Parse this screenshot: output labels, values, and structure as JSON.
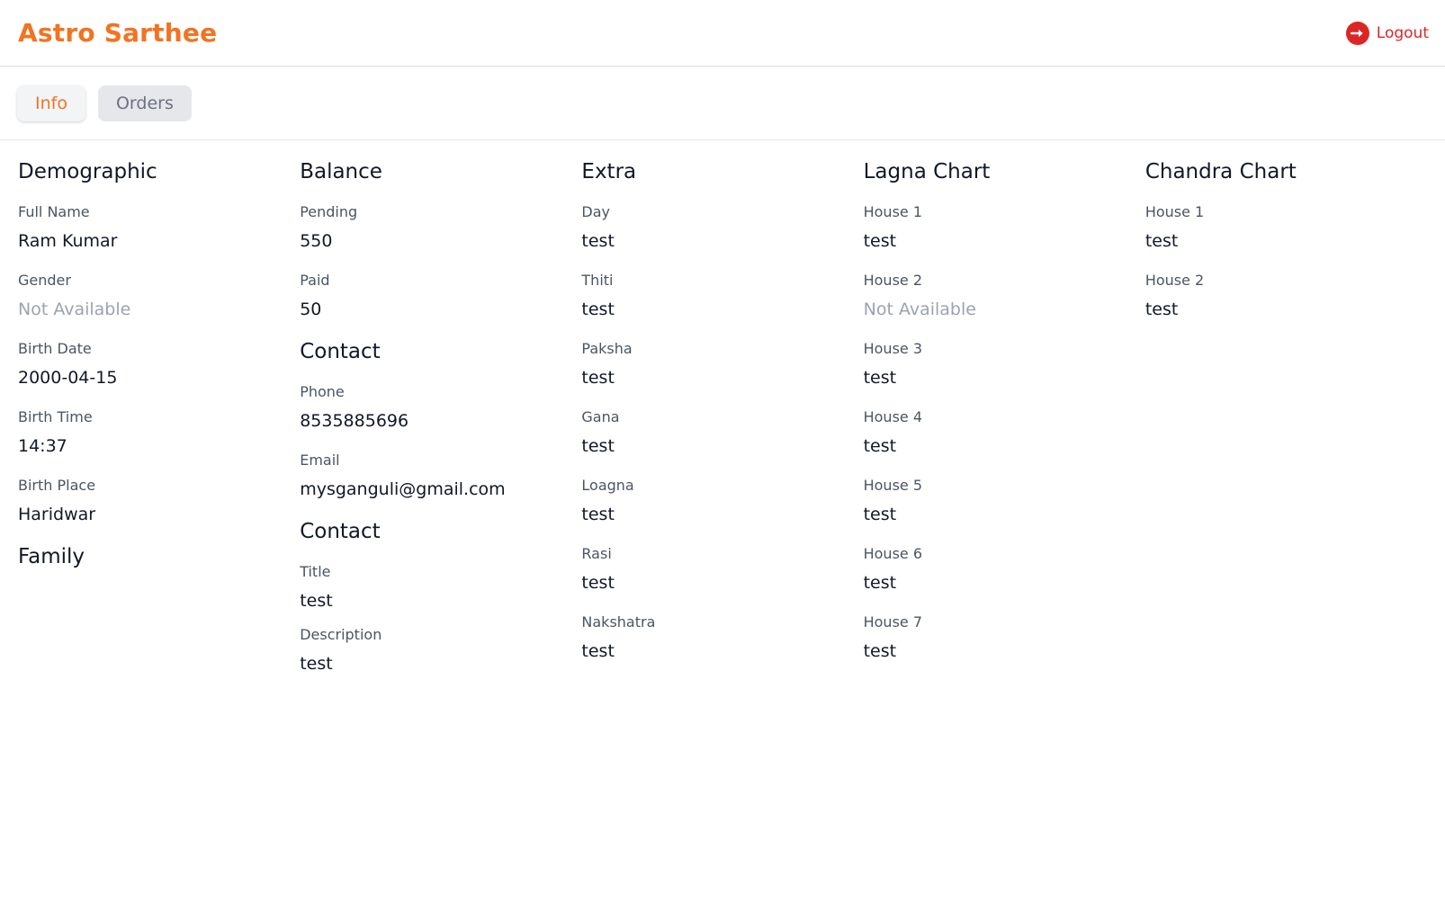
{
  "header": {
    "brand": "Astro Sarthee",
    "logout_label": "Logout"
  },
  "tabs": [
    {
      "label": "Info",
      "active": true
    },
    {
      "label": "Orders",
      "active": false
    }
  ],
  "demographic": {
    "title": "Demographic",
    "fields": [
      {
        "label": "Full Name",
        "value": "Ram Kumar"
      },
      {
        "label": "Gender",
        "value": "Not Available"
      },
      {
        "label": "Birth Date",
        "value": "2000-04-15"
      },
      {
        "label": "Birth Time",
        "value": "14:37"
      },
      {
        "label": "Birth Place",
        "value": "Haridwar"
      }
    ]
  },
  "family": {
    "title": "Family"
  },
  "balance": {
    "title": "Balance",
    "fields": [
      {
        "label": "Pending",
        "value": "550"
      },
      {
        "label": "Paid",
        "value": "50"
      }
    ]
  },
  "contact": {
    "title": "Contact",
    "fields": [
      {
        "label": "Phone",
        "value": "8535885696"
      },
      {
        "label": "Email",
        "value": "mysganguli@gmail.com"
      }
    ]
  },
  "contact2": {
    "title": "Contact",
    "fields": [
      {
        "label": "Title",
        "value": "test"
      },
      {
        "label": "Description",
        "value": "test"
      }
    ]
  },
  "extra": {
    "title": "Extra",
    "fields": [
      {
        "label": "Day",
        "value": "test"
      },
      {
        "label": "Thiti",
        "value": "test"
      },
      {
        "label": "Paksha",
        "value": "test"
      },
      {
        "label": "Gana",
        "value": "test"
      },
      {
        "label": "Loagna",
        "value": "test"
      },
      {
        "label": "Rasi",
        "value": "test"
      },
      {
        "label": "Nakshatra",
        "value": "test"
      }
    ]
  },
  "lagna": {
    "title": "Lagna Chart",
    "fields": [
      {
        "label": "House 1",
        "value": "test"
      },
      {
        "label": "House 2",
        "value": "Not Available"
      },
      {
        "label": "House 3",
        "value": "test"
      },
      {
        "label": "House 4",
        "value": "test"
      },
      {
        "label": "House 5",
        "value": "test"
      },
      {
        "label": "House 6",
        "value": "test"
      },
      {
        "label": "House 7",
        "value": "test"
      }
    ]
  },
  "chandra": {
    "title": "Chandra Chart",
    "fields": [
      {
        "label": "House 1",
        "value": "test"
      },
      {
        "label": "House 2",
        "value": "test"
      }
    ]
  },
  "colors": {
    "brand": "#f27321",
    "danger": "#dc2626",
    "muted": "#9ca3af"
  }
}
